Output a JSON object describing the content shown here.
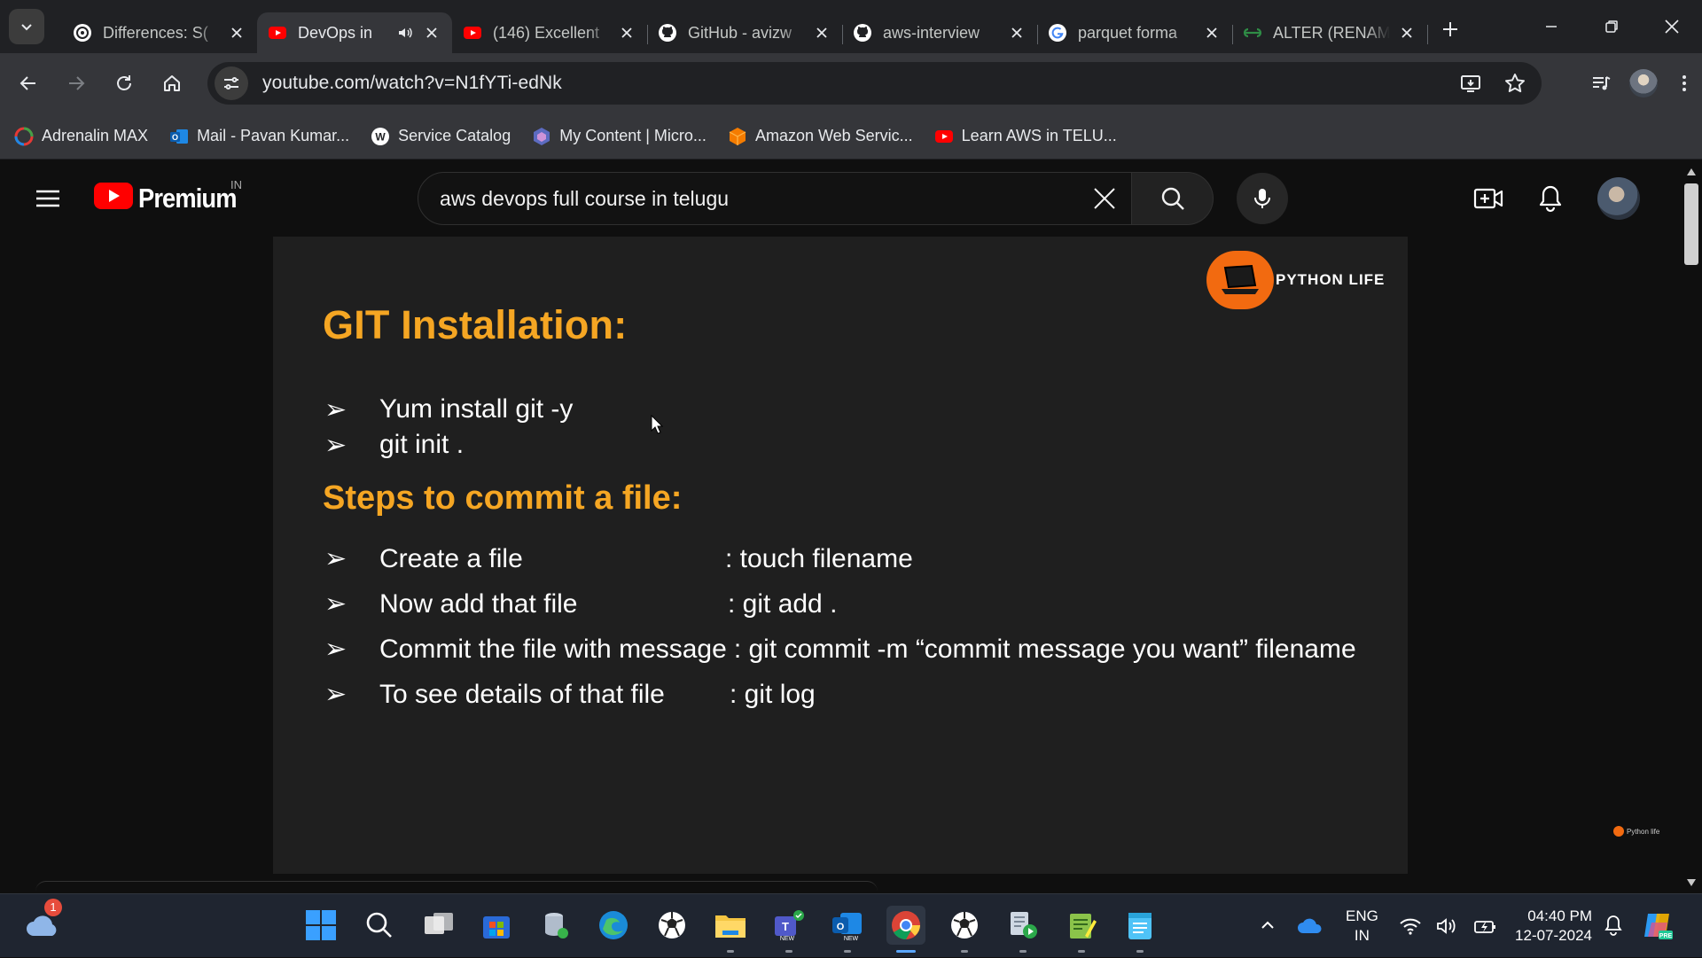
{
  "browser": {
    "tabs": [
      {
        "title": "Differences: S(",
        "icon": "openai-icon"
      },
      {
        "title": "DevOps in",
        "icon": "youtube-icon",
        "active": true,
        "audio": true
      },
      {
        "title": "(146) Excellent",
        "icon": "youtube-icon"
      },
      {
        "title": "GitHub - avizw",
        "icon": "github-icon"
      },
      {
        "title": "aws-interview",
        "icon": "github-icon"
      },
      {
        "title": "parquet forma",
        "icon": "google-icon"
      },
      {
        "title": "ALTER (RENAM",
        "icon": "gfg-icon"
      }
    ],
    "url": "youtube.com/watch?v=N1fYTi-edNk",
    "bookmarks": [
      {
        "label": "Adrenalin MAX",
        "icon": "adrenalin-icon"
      },
      {
        "label": "Mail - Pavan Kumar...",
        "icon": "outlook-icon"
      },
      {
        "label": "Service Catalog",
        "icon": "servicenow-icon"
      },
      {
        "label": "My Content | Micro...",
        "icon": "microsoft-content-icon"
      },
      {
        "label": "Amazon Web Servic...",
        "icon": "aws-icon"
      },
      {
        "label": "Learn AWS in TELU...",
        "icon": "youtube-icon"
      }
    ]
  },
  "youtube": {
    "logo_text": "Premium",
    "country_code": "IN",
    "search_query": "aws devops full course in telugu"
  },
  "slide": {
    "title": "GIT Installation:",
    "install_steps": [
      {
        "bullet": "➢",
        "text": "Yum install git -y"
      },
      {
        "bullet": "➢",
        "text": "git init ."
      }
    ],
    "steps_title": "Steps to commit a file:",
    "commit_steps": [
      {
        "bullet": "➢",
        "label": "Create a file",
        "command": ":  touch filename"
      },
      {
        "bullet": "➢",
        "label": "Now add that file",
        "command": ":  git add ."
      },
      {
        "bullet": "➢",
        "label": "Commit the file with message",
        "command": ": git commit -m “commit message you want” filename"
      },
      {
        "bullet": "➢",
        "label": "To see details of that file",
        "command": ": git log"
      }
    ],
    "logo_text": "PYTHON LIFE",
    "watermark": "Python life"
  },
  "taskbar": {
    "weather_badge": "1",
    "language": [
      "ENG",
      "IN"
    ],
    "time": "04:40 PM",
    "date": "12-07-2024"
  }
}
